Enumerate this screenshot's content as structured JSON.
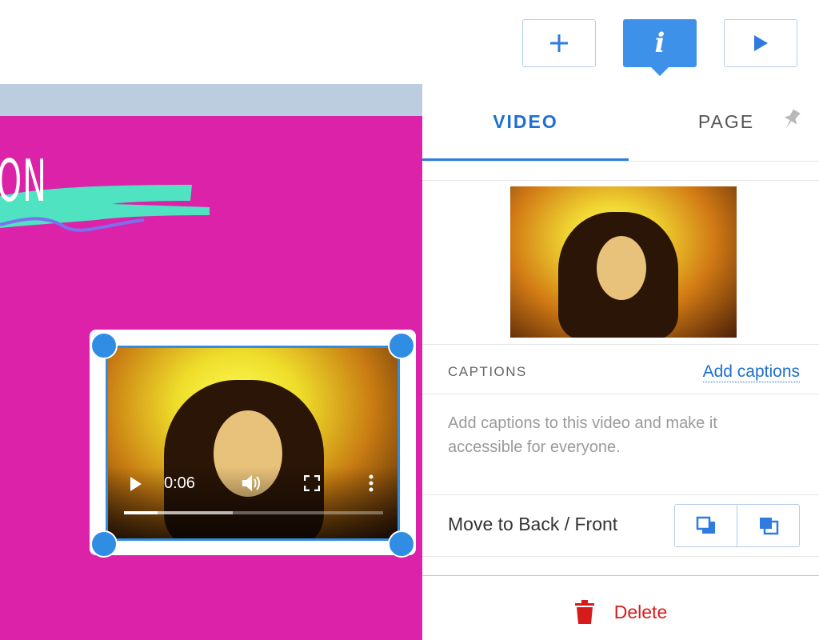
{
  "toolbar": {
    "add_icon": "plus-icon",
    "info_icon": "info-icon",
    "info_glyph": "i",
    "play_icon": "play-icon",
    "accent_color": "#3d91e8"
  },
  "canvas": {
    "background_color": "#dc22a8",
    "text_fragment": "ON",
    "video": {
      "time": "0:06",
      "progress": 0.13,
      "buffered": 0.42
    }
  },
  "panel": {
    "tabs": [
      {
        "label": "VIDEO",
        "active": true
      },
      {
        "label": "PAGE",
        "active": false
      }
    ],
    "captions": {
      "label": "CAPTIONS",
      "link": "Add captions",
      "description": "Add captions to this video and make it accessible for everyone."
    },
    "order": {
      "label": "Move to Back / Front"
    },
    "delete": {
      "label": "Delete",
      "color": "#d71b1b"
    }
  }
}
